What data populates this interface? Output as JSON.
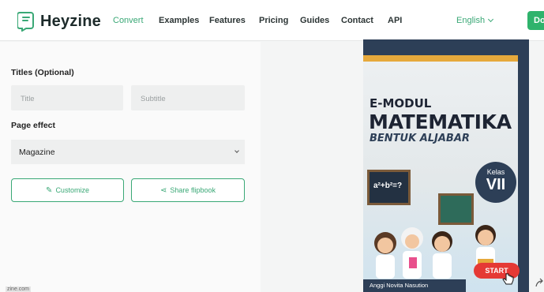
{
  "nav": {
    "brand": "Heyzine",
    "links": [
      {
        "label": "Convert",
        "active": true
      },
      {
        "label": "Examples",
        "active": false
      },
      {
        "label": "Features",
        "active": false
      },
      {
        "label": "Pricing",
        "active": false
      },
      {
        "label": "Guides",
        "active": false
      },
      {
        "label": "Contact",
        "active": false
      },
      {
        "label": "API",
        "active": false
      }
    ],
    "language": "English",
    "cta_label": "Do"
  },
  "form": {
    "titles_label": "Titles (Optional)",
    "title_placeholder": "Title",
    "subtitle_placeholder": "Subtitle",
    "page_effect_label": "Page effect",
    "page_effect_value": "Magazine",
    "customize_label": "Customize",
    "share_label": "Share flipbook"
  },
  "footer_tag": "zine.com",
  "cover": {
    "line1": "E-MODUL",
    "title": "MATEMATIKA",
    "subtitle": "BENTUK ALJABAR",
    "kelas_label": "Kelas",
    "kelas_num": "VII",
    "board_text": "a²+b²=?",
    "author": "Anggi Novita Nasution",
    "start_label": "START"
  },
  "colors": {
    "accent": "#3aa876",
    "cta": "#2fb36c",
    "cover_navy": "#2d3f57",
    "start_red": "#e53935"
  },
  "icons": [
    "logo-icon",
    "chevron-down-icon",
    "pencil-icon",
    "share-icon",
    "hand-cursor-icon"
  ]
}
